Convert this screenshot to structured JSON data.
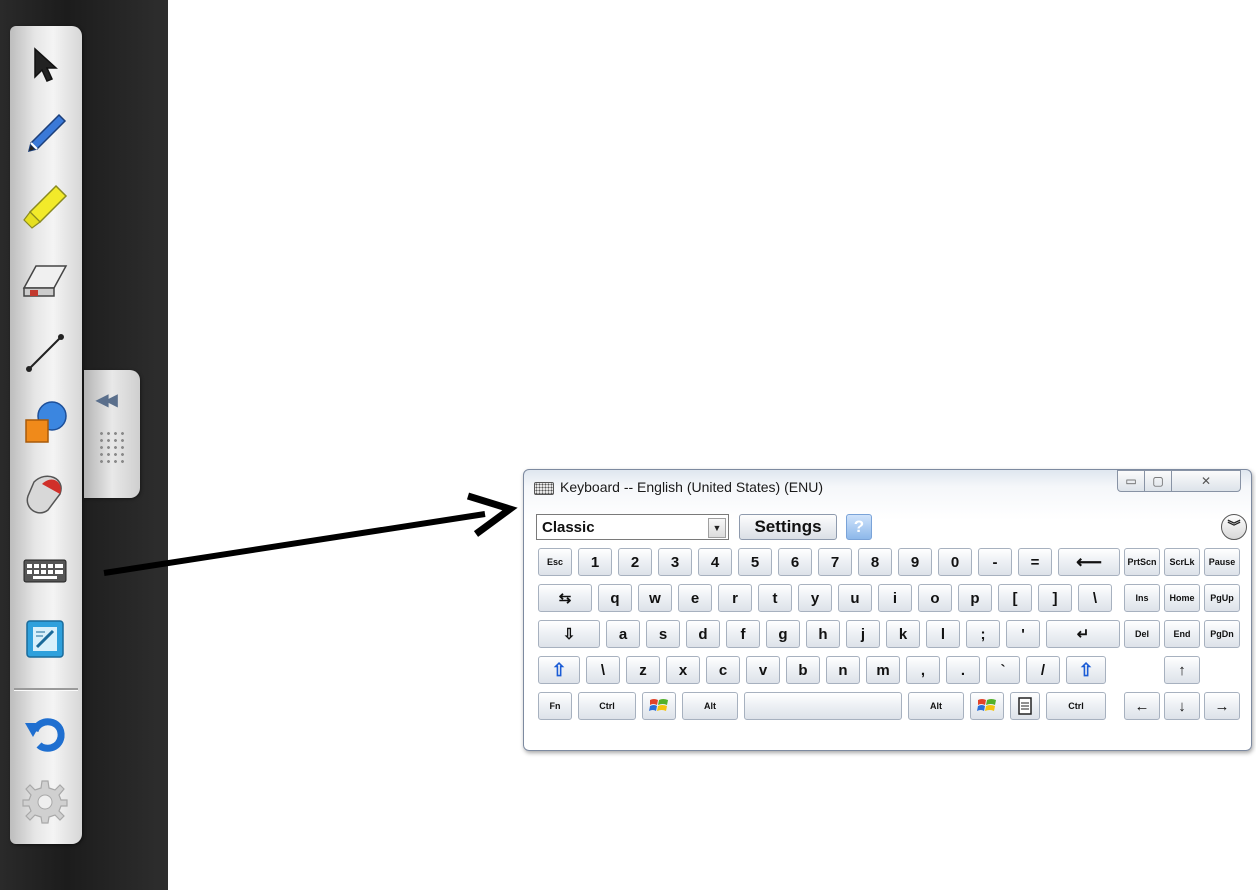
{
  "toolbar": {
    "tools": [
      {
        "name": "select-arrow-icon"
      },
      {
        "name": "pen-icon"
      },
      {
        "name": "highlighter-icon"
      },
      {
        "name": "eraser-icon"
      },
      {
        "name": "line-icon"
      },
      {
        "name": "shapes-icon"
      },
      {
        "name": "mouse-icon"
      },
      {
        "name": "keyboard-icon"
      },
      {
        "name": "notebook-icon"
      },
      {
        "name": "undo-icon"
      },
      {
        "name": "settings-gear-icon"
      }
    ],
    "collapse_glyph": "◀◀"
  },
  "keyboard": {
    "title": "Keyboard -- English (United States) (ENU)",
    "window_buttons": {
      "minimize": "▭",
      "maximize": "▢",
      "close": "✕"
    },
    "layout_select": {
      "value": "Classic",
      "arrow": "▼"
    },
    "settings_label": "Settings",
    "help_label": "?",
    "fade_label": "︾",
    "rows": [
      [
        "Esc",
        "1",
        "2",
        "3",
        "4",
        "5",
        "6",
        "7",
        "8",
        "9",
        "0",
        "-",
        "=",
        "⟵"
      ],
      [
        "⇆",
        "q",
        "w",
        "e",
        "r",
        "t",
        "y",
        "u",
        "i",
        "o",
        "p",
        "[",
        "]",
        "\\"
      ],
      [
        "⇩",
        "a",
        "s",
        "d",
        "f",
        "g",
        "h",
        "j",
        "k",
        "l",
        ";",
        "'",
        "↵"
      ],
      [
        "⇧",
        "\\",
        "z",
        "x",
        "c",
        "v",
        "b",
        "n",
        "m",
        ",",
        ".",
        "`",
        "/",
        "⇧"
      ],
      [
        "Fn",
        "Ctrl",
        "",
        "Alt",
        "",
        "Alt",
        "",
        "",
        "Ctrl"
      ]
    ],
    "nav_keys": {
      "row1": [
        "PrtScn",
        "ScrLk",
        "Pause"
      ],
      "row2": [
        "Ins",
        "Home",
        "PgUp"
      ],
      "row3": [
        "Del",
        "End",
        "PgDn"
      ],
      "up": "↑",
      "arrows": [
        "←",
        "↓",
        "→"
      ]
    },
    "colors": {
      "accent": "#1b5cd6",
      "help": "#8db8ea"
    }
  }
}
